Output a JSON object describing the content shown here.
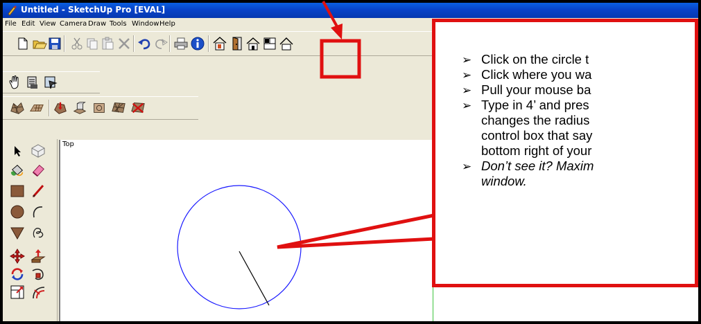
{
  "window": {
    "title": "Untitled - SketchUp Pro [EVAL]"
  },
  "menu": [
    "File",
    "Edit",
    "View",
    "Camera",
    "Draw",
    "Tools",
    "Window",
    "Help"
  ],
  "viewport": {
    "view_label": "Top"
  },
  "callout": {
    "bullets": [
      [
        "Click on the circle t"
      ],
      [
        "Click where you wa"
      ],
      [
        "Pull your mouse ba"
      ],
      [
        "Type in 4’ and pres",
        "changes the radius",
        "control box that say",
        "bottom right of your"
      ]
    ],
    "italic_bullet": [
      "Don’t see it? Maxim",
      "window."
    ]
  },
  "icons": {
    "toolbar1": [
      "new-icon",
      "open-icon",
      "save-icon",
      "cut-icon",
      "copy-icon",
      "paste-icon",
      "erase-icon",
      "undo-icon",
      "redo-icon",
      "print-icon",
      "model-info-icon",
      "house-wall-icon",
      "door-icon",
      "house-icon",
      "window-icon",
      "roof-icon"
    ],
    "toolbar2": [
      "hand-select-icon",
      "layers-icon",
      "outliner-icon"
    ],
    "toolbar3": [
      "terrain-icon",
      "stamp-icon",
      "drape-icon",
      "smoove-icon",
      "add-detail-icon",
      "flip-edge-icon",
      "sandbox-icon"
    ],
    "left": [
      "select-icon",
      "component-icon",
      "paint-bucket-icon",
      "eraser-icon",
      "rectangle-icon",
      "line-icon",
      "circle-icon",
      "arc-icon",
      "polygon-icon",
      "freehand-icon",
      "move-icon",
      "push-pull-icon",
      "rotate-icon",
      "follow-me-icon",
      "scale-icon",
      "offset-icon"
    ]
  },
  "colors": {
    "annotation_red": "#E01010",
    "circle_blue": "#1a1aff",
    "title_blue": "#0843C8",
    "green_axis": "#3ec43e"
  }
}
